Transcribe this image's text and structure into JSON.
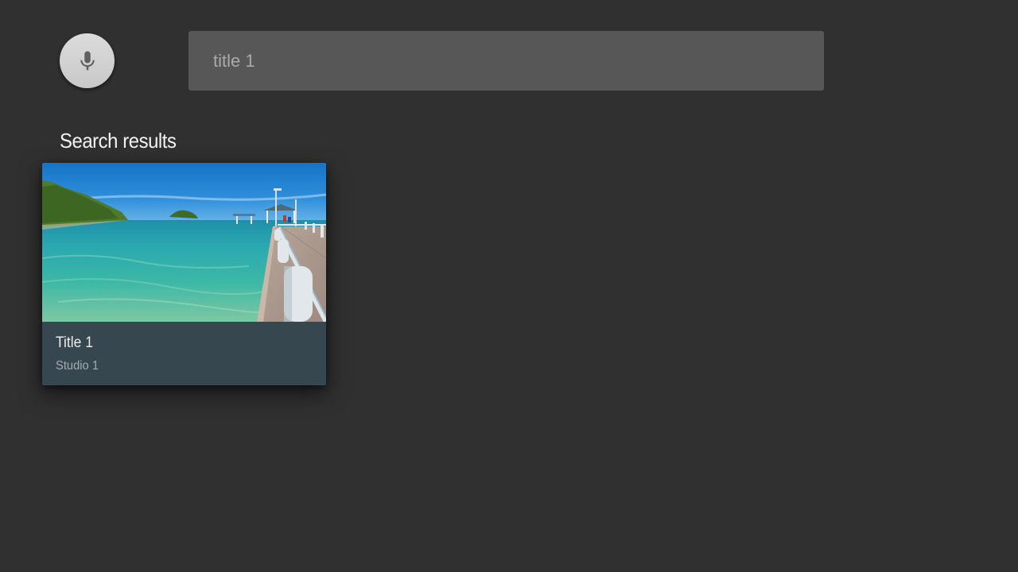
{
  "search": {
    "value": "title 1",
    "mic_icon": "microphone-icon"
  },
  "results": {
    "heading": "Search results",
    "items": [
      {
        "title": "Title 1",
        "subtitle": "Studio 1",
        "image": "tropical-pier-photo"
      }
    ]
  },
  "colors": {
    "background": "#303030",
    "search_box": "#575757",
    "card_info": "#37474f",
    "mic_button": "#d0d0d0"
  }
}
